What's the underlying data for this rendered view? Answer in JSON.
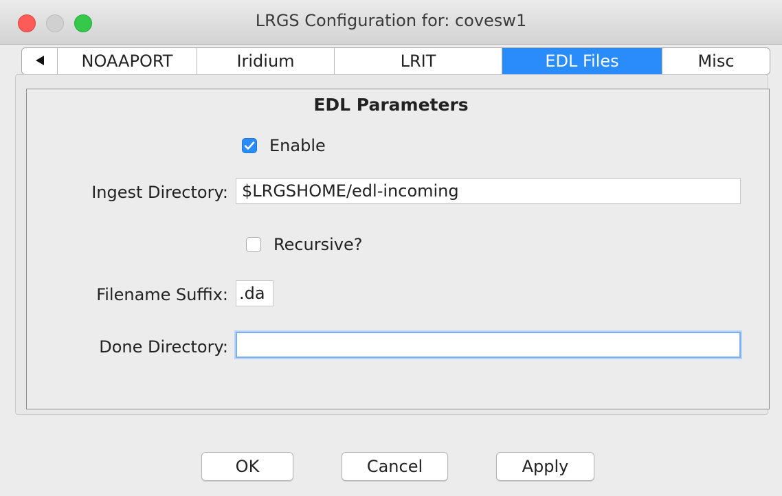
{
  "window": {
    "title": "LRGS Configuration for:  covesw1"
  },
  "tabs": {
    "scroll_left_icon": "triangle-left",
    "items": [
      {
        "label": "NOAAPORT",
        "selected": false
      },
      {
        "label": "Iridium",
        "selected": false
      },
      {
        "label": "LRIT",
        "selected": false
      },
      {
        "label": "EDL Files",
        "selected": true
      },
      {
        "label": "Misc",
        "selected": false
      }
    ]
  },
  "edl": {
    "title": "EDL Parameters",
    "enable_label": "Enable",
    "enable_checked": true,
    "ingest_label": "Ingest Directory:",
    "ingest_value": "$LRGSHOME/edl-incoming",
    "recursive_label": "Recursive?",
    "recursive_checked": false,
    "suffix_label": "Filename Suffix:",
    "suffix_value": ".da",
    "done_label": "Done Directory:",
    "done_value": ""
  },
  "buttons": {
    "ok": "OK",
    "cancel": "Cancel",
    "apply": "Apply"
  },
  "colors": {
    "accent": "#2a8cfa",
    "close": "#fc5b57",
    "zoom": "#35c84a"
  }
}
